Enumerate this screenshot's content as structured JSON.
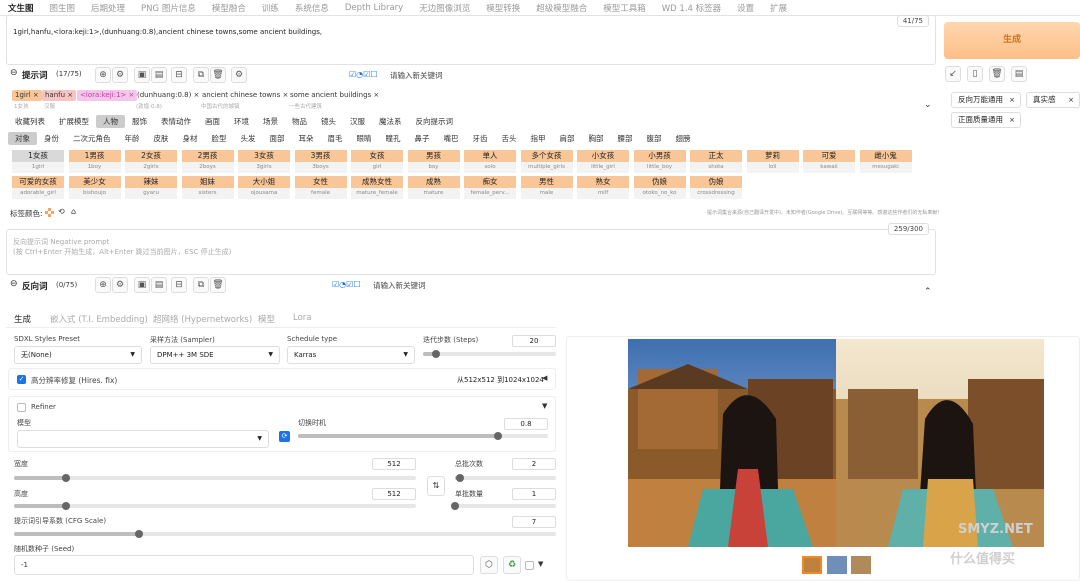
{
  "top_tabs": [
    "文生图",
    "图生图",
    "后期处理",
    "PNG 图片信息",
    "模型融合",
    "训练",
    "系统信息",
    "Depth Library",
    "无边图像浏览",
    "模型转换",
    "超级模型融合",
    "模型工具箱",
    "WD 1.4 标签器",
    "设置",
    "扩展"
  ],
  "prompt": {
    "text": "1girl,hanfu,<lora:keji:1>,(dunhuang:0.8),ancient chinese towns,some ancient buildings,",
    "counter": "41/75",
    "label": "提示词",
    "count": "(17/75)",
    "keyword_placeholder": "请输入新关键词"
  },
  "prompt_chips": [
    {
      "text": "1girl",
      "sub": "1女孩"
    },
    {
      "text": "hanfu",
      "sub": "汉服"
    },
    {
      "text": "<lora:keji:1>",
      "sub": ""
    },
    {
      "text": "(dunhuang:0.8)",
      "sub": "(敦煌:0.8)"
    },
    {
      "text": "ancient chinese towns",
      "sub": "中国古代的城镇"
    },
    {
      "text": "some ancient buildings",
      "sub": "一些古代建筑"
    }
  ],
  "generate_button": "生成",
  "right_styles": [
    {
      "text": "反向万能通用"
    },
    {
      "text": "真实感"
    },
    {
      "text": "正面质量通用"
    }
  ],
  "category_tabs": [
    "收藏列表",
    "扩展模型",
    "人物",
    "服饰",
    "表情动作",
    "画面",
    "环境",
    "场景",
    "物品",
    "镜头",
    "汉服",
    "魔法系",
    "反向提示词"
  ],
  "sub_tabs": [
    "对象",
    "身份",
    "二次元角色",
    "年龄",
    "皮肤",
    "身材",
    "脸型",
    "头发",
    "面部",
    "耳朵",
    "眉毛",
    "眼睛",
    "瞳孔",
    "鼻子",
    "嘴巴",
    "牙齿",
    "舌头",
    "指甲",
    "肩部",
    "胸部",
    "腰部",
    "腹部",
    "翅膀"
  ],
  "tags": [
    {
      "cn": "1女孩",
      "en": "1girl"
    },
    {
      "cn": "1男孩",
      "en": "1boy"
    },
    {
      "cn": "2女孩",
      "en": "2girls"
    },
    {
      "cn": "2男孩",
      "en": "2boys"
    },
    {
      "cn": "3女孩",
      "en": "3girls"
    },
    {
      "cn": "3男孩",
      "en": "3boys"
    },
    {
      "cn": "女孩",
      "en": "girl"
    },
    {
      "cn": "男孩",
      "en": "boy"
    },
    {
      "cn": "单人",
      "en": "solo"
    },
    {
      "cn": "多个女孩",
      "en": "multiple_girls"
    },
    {
      "cn": "小女孩",
      "en": "little_girl"
    },
    {
      "cn": "小男孩",
      "en": "little_boy"
    },
    {
      "cn": "正太",
      "en": "shota"
    },
    {
      "cn": "萝莉",
      "en": "loli"
    },
    {
      "cn": "可爱",
      "en": "kawaii"
    },
    {
      "cn": "雌小鬼",
      "en": "mesugaki"
    },
    {
      "cn": "可爱的女孩",
      "en": "adorable_girl"
    },
    {
      "cn": "美少女",
      "en": "bishoujo"
    },
    {
      "cn": "辣妹",
      "en": "gyaru"
    },
    {
      "cn": "姐妹",
      "en": "sisters"
    },
    {
      "cn": "大小姐",
      "en": "ojousama"
    },
    {
      "cn": "女性",
      "en": "female"
    },
    {
      "cn": "成熟女性",
      "en": "mature_female"
    },
    {
      "cn": "成熟",
      "en": "mature"
    },
    {
      "cn": "痴女",
      "en": "female_perv..."
    },
    {
      "cn": "男性",
      "en": "male"
    },
    {
      "cn": "熟女",
      "en": "milf"
    },
    {
      "cn": "伪娘",
      "en": "otoko_no_ko"
    },
    {
      "cn": "伪娘",
      "en": "crossdressing"
    }
  ],
  "tag_color_label": "标签颜色:",
  "tag_hint": "提示词集合来源(自己翻译开发中)、未知作者(Google Drive)、互联网等等。感谢这些作者们的无私奉献！",
  "negative": {
    "placeholder": "反向提示词 Negative prompt\n(按 Ctrl+Enter 开始生成，Alt+Enter 跳过当前图片，ESC 停止生成)",
    "counter": "259/300",
    "label": "反向词",
    "count": "(0/75)",
    "keyword_placeholder": "请输入新关键词"
  },
  "gen_tabs": [
    "生成",
    "嵌入式 (T.I. Embedding)",
    "超网络 (Hypernetworks)",
    "模型",
    "Lora"
  ],
  "settings": {
    "sdxl_label": "SDXL Styles Preset",
    "sdxl_value": "无(None)",
    "sampler_label": "采样方法 (Sampler)",
    "sampler_value": "DPM++ 3M SDE",
    "schedule_label": "Schedule type",
    "schedule_value": "Karras",
    "steps_label": "迭代步数 (Steps)",
    "steps_value": "20",
    "hires_label": "高分辨率修复 (Hires. fix)",
    "hires_info": "从512x512 到1024x1024",
    "refiner_label": "Refiner",
    "model_label": "模型",
    "switch_label": "切换时机",
    "switch_value": "0.8",
    "width_label": "宽度",
    "width_value": "512",
    "height_label": "高度",
    "height_value": "512",
    "batch_count_label": "总批次数",
    "batch_count_value": "2",
    "batch_size_label": "单批数量",
    "batch_size_value": "1",
    "cfg_label": "提示词引导系数 (CFG Scale)",
    "cfg_value": "7",
    "seed_label": "随机数种子 (Seed)",
    "seed_value": "-1"
  },
  "sliders": {
    "steps": 0.1,
    "switch": 0.8,
    "width": 0.13,
    "height": 0.13,
    "batch_count": 0.05,
    "batch_size": 0.0,
    "cfg": 0.23
  },
  "watermark": "什么值得买",
  "watermark_sub": "SMYZ.NET"
}
